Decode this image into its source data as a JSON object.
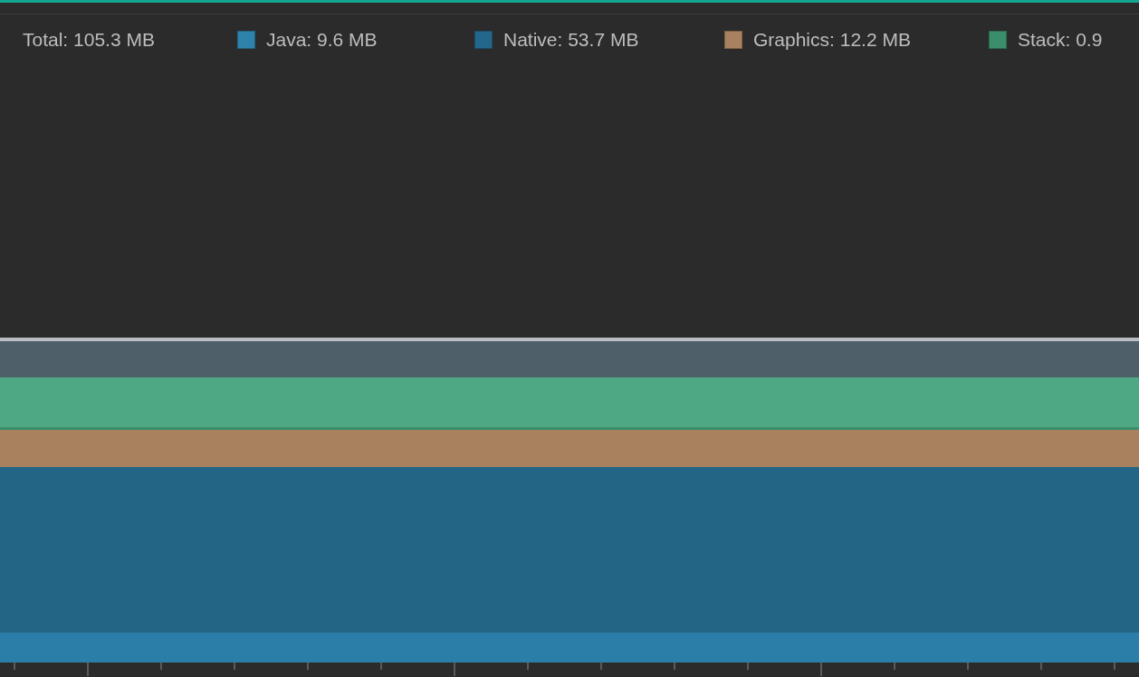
{
  "legend": [
    {
      "label": "Total: 105.3 MB",
      "kind": "total"
    },
    {
      "label": "Java: 9.6 MB",
      "kind": "series",
      "color": "#2e83ad"
    },
    {
      "label": "Native: 53.7 MB",
      "kind": "series",
      "color": "#23678a"
    },
    {
      "label": "Graphics: 12.2 MB",
      "kind": "series",
      "color": "#a8825e"
    },
    {
      "label": "Stack: 0.9",
      "kind": "series",
      "color": "#3b8e6a"
    }
  ]
}
